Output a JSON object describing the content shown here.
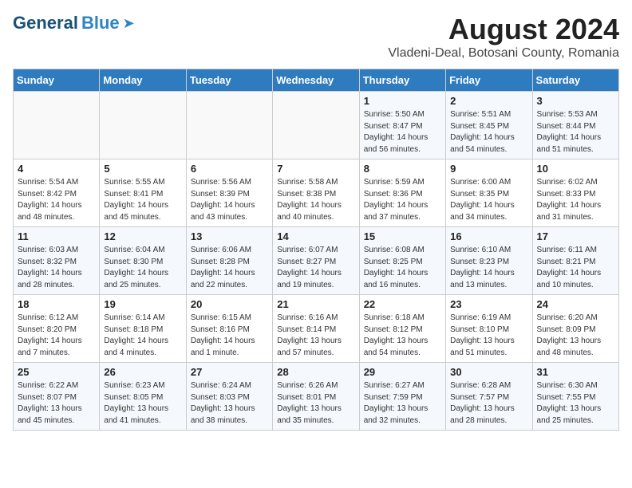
{
  "header": {
    "logo_general": "General",
    "logo_blue": "Blue",
    "month_year": "August 2024",
    "location": "Vladeni-Deal, Botosani County, Romania"
  },
  "weekdays": [
    "Sunday",
    "Monday",
    "Tuesday",
    "Wednesday",
    "Thursday",
    "Friday",
    "Saturday"
  ],
  "weeks": [
    [
      {
        "day": "",
        "detail": ""
      },
      {
        "day": "",
        "detail": ""
      },
      {
        "day": "",
        "detail": ""
      },
      {
        "day": "",
        "detail": ""
      },
      {
        "day": "1",
        "detail": "Sunrise: 5:50 AM\nSunset: 8:47 PM\nDaylight: 14 hours\nand 56 minutes."
      },
      {
        "day": "2",
        "detail": "Sunrise: 5:51 AM\nSunset: 8:45 PM\nDaylight: 14 hours\nand 54 minutes."
      },
      {
        "day": "3",
        "detail": "Sunrise: 5:53 AM\nSunset: 8:44 PM\nDaylight: 14 hours\nand 51 minutes."
      }
    ],
    [
      {
        "day": "4",
        "detail": "Sunrise: 5:54 AM\nSunset: 8:42 PM\nDaylight: 14 hours\nand 48 minutes."
      },
      {
        "day": "5",
        "detail": "Sunrise: 5:55 AM\nSunset: 8:41 PM\nDaylight: 14 hours\nand 45 minutes."
      },
      {
        "day": "6",
        "detail": "Sunrise: 5:56 AM\nSunset: 8:39 PM\nDaylight: 14 hours\nand 43 minutes."
      },
      {
        "day": "7",
        "detail": "Sunrise: 5:58 AM\nSunset: 8:38 PM\nDaylight: 14 hours\nand 40 minutes."
      },
      {
        "day": "8",
        "detail": "Sunrise: 5:59 AM\nSunset: 8:36 PM\nDaylight: 14 hours\nand 37 minutes."
      },
      {
        "day": "9",
        "detail": "Sunrise: 6:00 AM\nSunset: 8:35 PM\nDaylight: 14 hours\nand 34 minutes."
      },
      {
        "day": "10",
        "detail": "Sunrise: 6:02 AM\nSunset: 8:33 PM\nDaylight: 14 hours\nand 31 minutes."
      }
    ],
    [
      {
        "day": "11",
        "detail": "Sunrise: 6:03 AM\nSunset: 8:32 PM\nDaylight: 14 hours\nand 28 minutes."
      },
      {
        "day": "12",
        "detail": "Sunrise: 6:04 AM\nSunset: 8:30 PM\nDaylight: 14 hours\nand 25 minutes."
      },
      {
        "day": "13",
        "detail": "Sunrise: 6:06 AM\nSunset: 8:28 PM\nDaylight: 14 hours\nand 22 minutes."
      },
      {
        "day": "14",
        "detail": "Sunrise: 6:07 AM\nSunset: 8:27 PM\nDaylight: 14 hours\nand 19 minutes."
      },
      {
        "day": "15",
        "detail": "Sunrise: 6:08 AM\nSunset: 8:25 PM\nDaylight: 14 hours\nand 16 minutes."
      },
      {
        "day": "16",
        "detail": "Sunrise: 6:10 AM\nSunset: 8:23 PM\nDaylight: 14 hours\nand 13 minutes."
      },
      {
        "day": "17",
        "detail": "Sunrise: 6:11 AM\nSunset: 8:21 PM\nDaylight: 14 hours\nand 10 minutes."
      }
    ],
    [
      {
        "day": "18",
        "detail": "Sunrise: 6:12 AM\nSunset: 8:20 PM\nDaylight: 14 hours\nand 7 minutes."
      },
      {
        "day": "19",
        "detail": "Sunrise: 6:14 AM\nSunset: 8:18 PM\nDaylight: 14 hours\nand 4 minutes."
      },
      {
        "day": "20",
        "detail": "Sunrise: 6:15 AM\nSunset: 8:16 PM\nDaylight: 14 hours\nand 1 minute."
      },
      {
        "day": "21",
        "detail": "Sunrise: 6:16 AM\nSunset: 8:14 PM\nDaylight: 13 hours\nand 57 minutes."
      },
      {
        "day": "22",
        "detail": "Sunrise: 6:18 AM\nSunset: 8:12 PM\nDaylight: 13 hours\nand 54 minutes."
      },
      {
        "day": "23",
        "detail": "Sunrise: 6:19 AM\nSunset: 8:10 PM\nDaylight: 13 hours\nand 51 minutes."
      },
      {
        "day": "24",
        "detail": "Sunrise: 6:20 AM\nSunset: 8:09 PM\nDaylight: 13 hours\nand 48 minutes."
      }
    ],
    [
      {
        "day": "25",
        "detail": "Sunrise: 6:22 AM\nSunset: 8:07 PM\nDaylight: 13 hours\nand 45 minutes."
      },
      {
        "day": "26",
        "detail": "Sunrise: 6:23 AM\nSunset: 8:05 PM\nDaylight: 13 hours\nand 41 minutes."
      },
      {
        "day": "27",
        "detail": "Sunrise: 6:24 AM\nSunset: 8:03 PM\nDaylight: 13 hours\nand 38 minutes."
      },
      {
        "day": "28",
        "detail": "Sunrise: 6:26 AM\nSunset: 8:01 PM\nDaylight: 13 hours\nand 35 minutes."
      },
      {
        "day": "29",
        "detail": "Sunrise: 6:27 AM\nSunset: 7:59 PM\nDaylight: 13 hours\nand 32 minutes."
      },
      {
        "day": "30",
        "detail": "Sunrise: 6:28 AM\nSunset: 7:57 PM\nDaylight: 13 hours\nand 28 minutes."
      },
      {
        "day": "31",
        "detail": "Sunrise: 6:30 AM\nSunset: 7:55 PM\nDaylight: 13 hours\nand 25 minutes."
      }
    ]
  ]
}
